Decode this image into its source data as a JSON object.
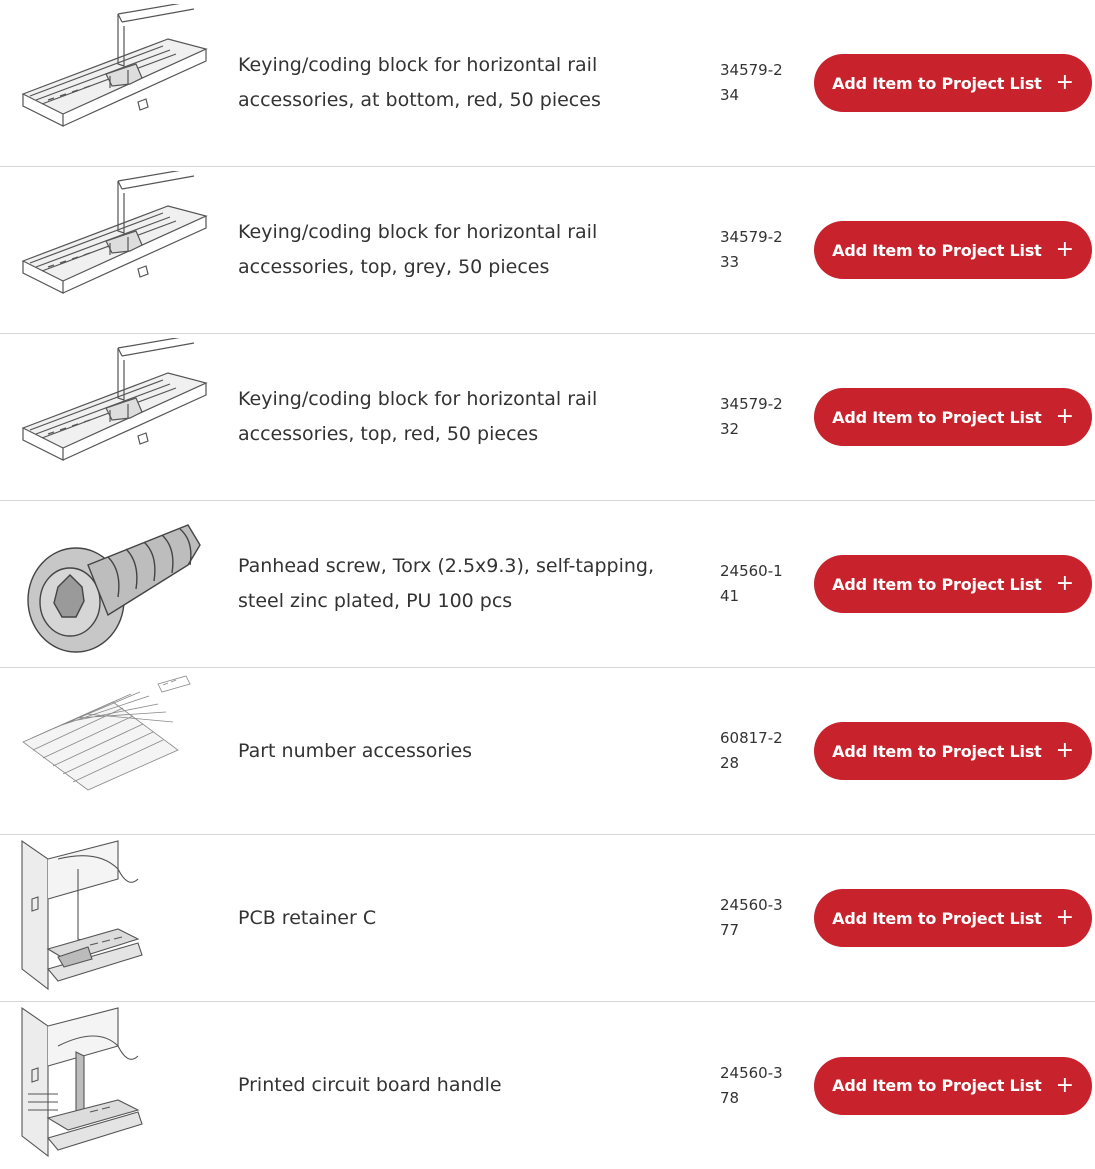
{
  "button_color": "#c8232c",
  "products": [
    {
      "icon": "keying-block-rail-image",
      "description": "Keying/coding block for horizontal rail accessories, at bottom, red, 50 pieces",
      "part_number": "34579-234",
      "button_label": "Add Item to Project List",
      "button_icon": "plus-icon",
      "plus": "+"
    },
    {
      "icon": "keying-block-rail-image",
      "description": "Keying/coding block for horizontal rail accessories, top, grey, 50 pieces",
      "part_number": "34579-233",
      "button_label": "Add Item to Project List",
      "button_icon": "plus-icon",
      "plus": "+"
    },
    {
      "icon": "keying-block-rail-image",
      "description": "Keying/coding block for horizontal rail accessories, top, red, 50 pieces",
      "part_number": "34579-232",
      "button_label": "Add Item to Project List",
      "button_icon": "plus-icon",
      "plus": "+"
    },
    {
      "icon": "torx-screw-image",
      "description": "Panhead screw, Torx (2.5x9.3), self-tapping, steel zinc plated, PU 100 pcs",
      "part_number": "24560-141",
      "button_label": "Add Item to Project List",
      "button_icon": "plus-icon",
      "plus": "+"
    },
    {
      "icon": "label-sheet-image",
      "description": "Part number accessories",
      "part_number": "60817-228",
      "button_label": "Add Item to Project List",
      "button_icon": "plus-icon",
      "plus": "+"
    },
    {
      "icon": "pcb-retainer-image",
      "description": "PCB retainer C",
      "part_number": "24560-377",
      "button_label": "Add Item to Project List",
      "button_icon": "plus-icon",
      "plus": "+"
    },
    {
      "icon": "pcb-handle-image",
      "description": "Printed circuit board handle",
      "part_number": "24560-378",
      "button_label": "Add Item to Project List",
      "button_icon": "plus-icon",
      "plus": "+"
    }
  ]
}
